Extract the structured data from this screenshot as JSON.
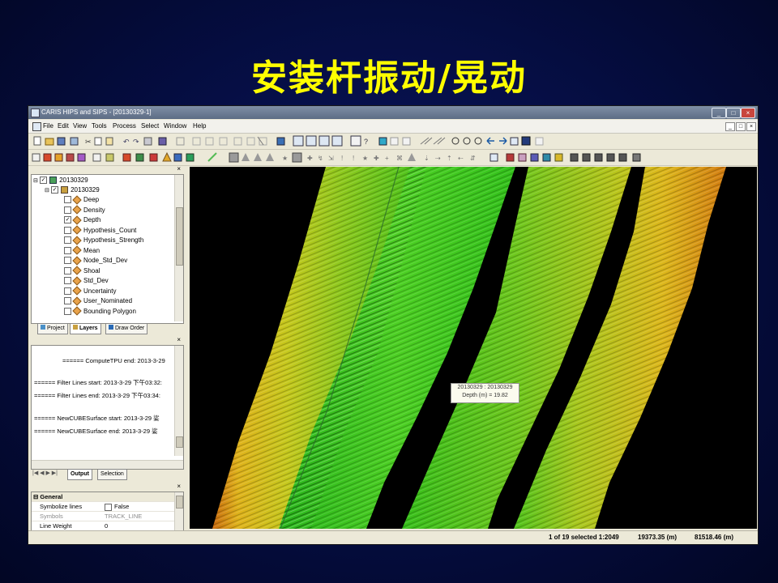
{
  "slide_title": "安装杆振动/晃动",
  "window": {
    "title": "CARIS HIPS and SIPS - [20130329-1]",
    "controls": [
      "_",
      "□",
      "×"
    ],
    "mdi_controls": [
      "_",
      "□",
      "×"
    ]
  },
  "menu": [
    "File",
    "Edit",
    "View",
    "Tools",
    "Process",
    "Select",
    "Window",
    "Help"
  ],
  "layers_tree": {
    "root": "20130329",
    "group": "20130329",
    "items": [
      "Deep",
      "Density",
      "Depth",
      "Hypothesis_Count",
      "Hypothesis_Strength",
      "Mean",
      "Node_Std_Dev",
      "Shoal",
      "Std_Dev",
      "Uncertainty",
      "User_Nominated",
      "Bounding Polygon"
    ],
    "checked_item": "Depth"
  },
  "layer_tabs": [
    "Project",
    "Layers",
    "Draw Order"
  ],
  "output_lines": [
    "====== ComputeTPU end: 2013-3-29",
    "====== Filter Lines start: 2013-3-29 下午03:32:",
    "====== Filter Lines end: 2013-3-29 下午03:34:",
    "====== NewCUBESurface start: 2013-3-29 娑",
    "====== NewCUBESurface end: 2013-3-29 娑"
  ],
  "output_tabs": [
    "Output",
    "Selection"
  ],
  "properties": {
    "section": "General",
    "rows": [
      {
        "label": "Symbolize lines",
        "value": "False"
      },
      {
        "label": "Symbols",
        "value": "TRACK_LINE"
      },
      {
        "label": "Line Weight",
        "value": "0"
      }
    ]
  },
  "map_tooltip": {
    "line1": "20130329 : 20130329",
    "line2": "Depth (m) = 19.82"
  },
  "status": {
    "selection": "1 of 19 selected 1:2049",
    "x": "19373.35 (m)",
    "y": "81518.46 (m)"
  },
  "colors": {
    "title_yellow": "#ffff00",
    "slide_bg": "#060f4a",
    "seabed_green": "#3ec21a",
    "seabed_yellow": "#d8c21a",
    "seabed_orange": "#d88a16"
  }
}
